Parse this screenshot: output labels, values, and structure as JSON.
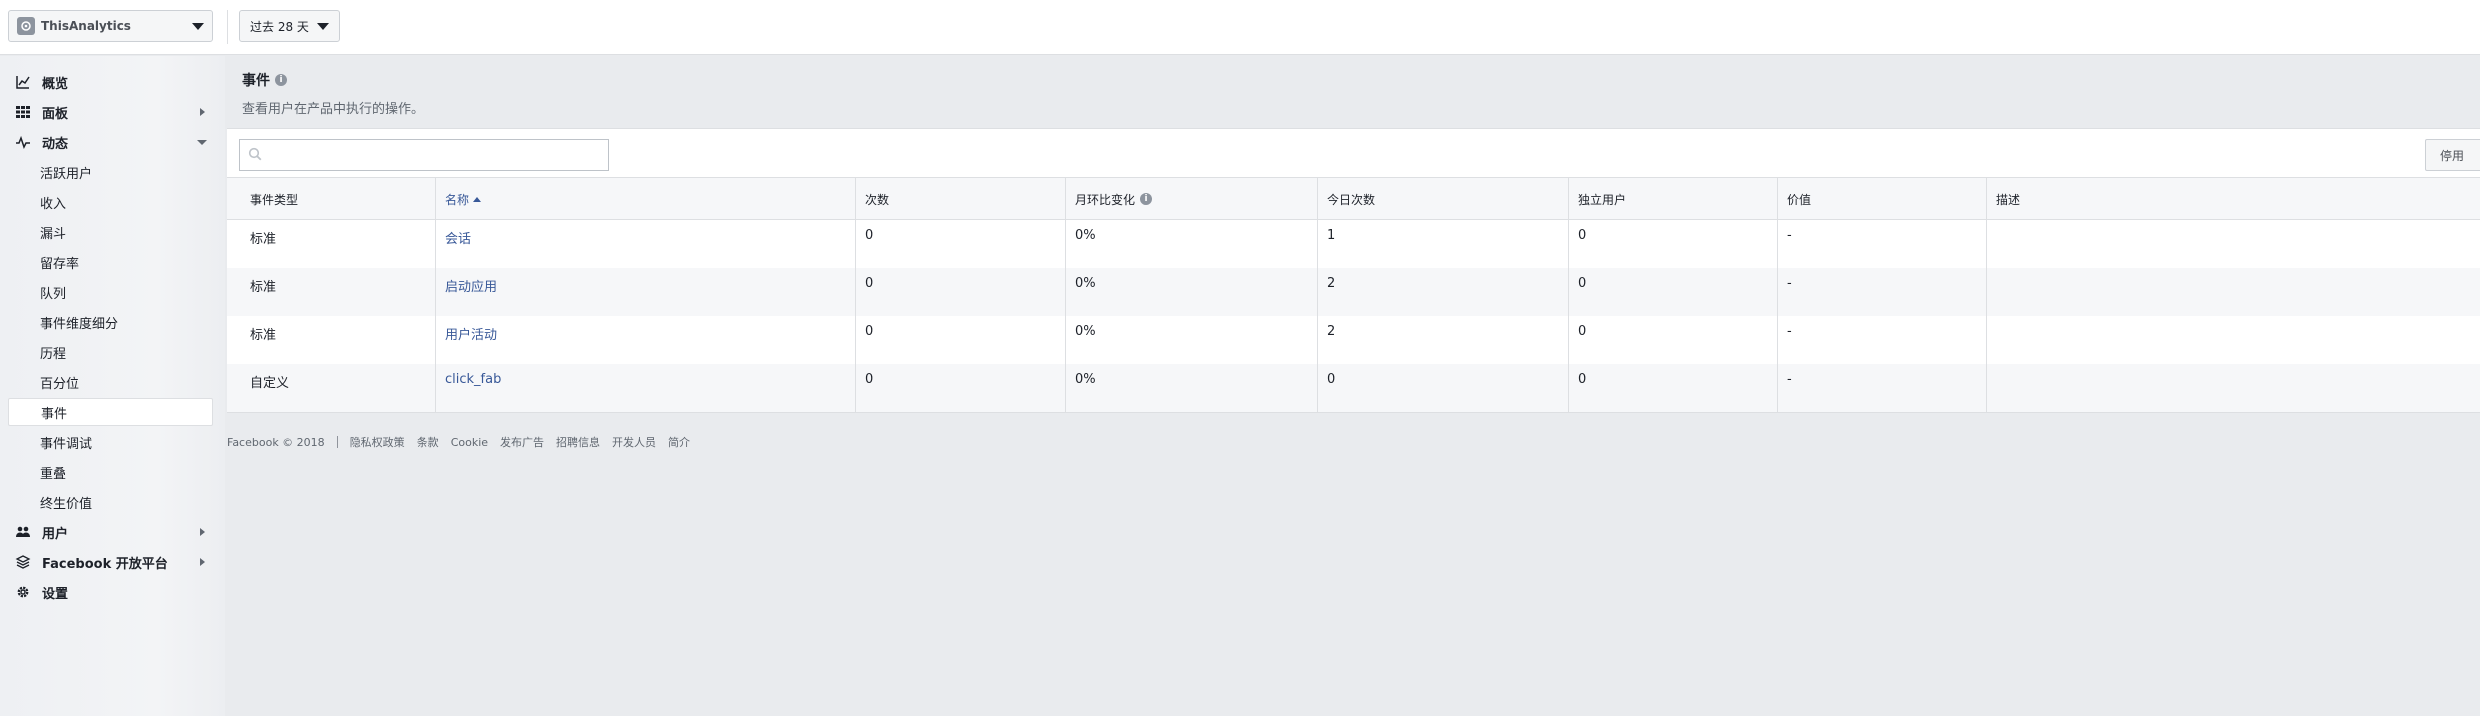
{
  "topbar": {
    "app_name": "ThisAnalytics",
    "date_range": "过去 28 天"
  },
  "sidebar": {
    "items": [
      {
        "label": "概览",
        "icon": "chart-line-icon"
      },
      {
        "label": "面板",
        "icon": "grid-icon"
      },
      {
        "label": "动态",
        "icon": "pulse-icon"
      },
      {
        "label": "活跃用户"
      },
      {
        "label": "收入"
      },
      {
        "label": "漏斗"
      },
      {
        "label": "留存率"
      },
      {
        "label": "队列"
      },
      {
        "label": "事件维度细分"
      },
      {
        "label": "历程"
      },
      {
        "label": "百分位"
      },
      {
        "label": "事件"
      },
      {
        "label": "事件调试"
      },
      {
        "label": "重叠"
      },
      {
        "label": "终生价值"
      },
      {
        "label": "用户",
        "icon": "people-icon"
      },
      {
        "label": "Facebook 开放平台",
        "icon": "layers-icon"
      },
      {
        "label": "设置",
        "icon": "gear-icon"
      }
    ]
  },
  "header": {
    "title": "事件",
    "info": "i",
    "subtitle": "查看用户在产品中执行的操作。"
  },
  "toolbar": {
    "search_placeholder": "",
    "disable_label": "停用"
  },
  "table": {
    "columns": [
      "事件类型",
      "名称",
      "次数",
      "月环比变化",
      "今日次数",
      "独立用户",
      "价值",
      "描述"
    ],
    "rows": [
      [
        "标准",
        "会话",
        "0",
        "0%",
        "1",
        "0",
        "-",
        ""
      ],
      [
        "标准",
        "启动应用",
        "0",
        "0%",
        "2",
        "0",
        "-",
        ""
      ],
      [
        "标准",
        "用户活动",
        "0",
        "0%",
        "2",
        "0",
        "-",
        ""
      ],
      [
        "自定义",
        "click_fab",
        "0",
        "0%",
        "0",
        "0",
        "-",
        ""
      ]
    ]
  },
  "footer": {
    "copyright": "Facebook © 2018",
    "links": [
      "隐私权政策",
      "条款",
      "Cookie",
      "发布广告",
      "招聘信息",
      "开发人员",
      "简介"
    ]
  },
  "colors": {
    "link": "#385898",
    "background": "#e9ebee"
  }
}
